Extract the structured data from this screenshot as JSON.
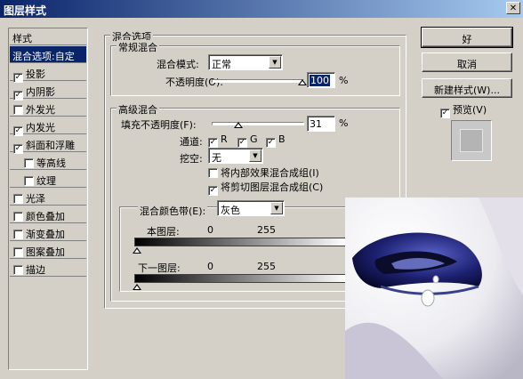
{
  "window": {
    "title": "图层样式",
    "close_glyph": "✕"
  },
  "style_list": {
    "header": "样式",
    "blend_options": "混合选项:自定",
    "items": [
      {
        "label": "投影",
        "checked": true
      },
      {
        "label": "内阴影",
        "checked": true
      },
      {
        "label": "外发光",
        "checked": false
      },
      {
        "label": "内发光",
        "checked": true
      },
      {
        "label": "斜面和浮雕",
        "checked": true
      },
      {
        "label": "等高线",
        "checked": false
      },
      {
        "label": "纹理",
        "checked": false
      },
      {
        "label": "光泽",
        "checked": false
      },
      {
        "label": "颜色叠加",
        "checked": false
      },
      {
        "label": "渐变叠加",
        "checked": false
      },
      {
        "label": "图案叠加",
        "checked": false
      },
      {
        "label": "描边",
        "checked": false
      }
    ]
  },
  "blend_options": {
    "title": "混合选项",
    "general": {
      "title": "常规混合",
      "mode_label": "混合模式:",
      "mode_value": "正常",
      "opacity_label": "不透明度(O):",
      "opacity_value": "100",
      "opacity_unit": "%"
    },
    "advanced": {
      "title": "高级混合",
      "fill_label": "填充不透明度(F):",
      "fill_value": "31",
      "fill_unit": "%",
      "channels_label": "通道:",
      "channels": [
        {
          "label": "R",
          "checked": true
        },
        {
          "label": "G",
          "checked": true
        },
        {
          "label": "B",
          "checked": true
        }
      ],
      "knockout_label": "挖空:",
      "knockout_value": "无",
      "check_inner_effects": {
        "label": "将内部效果混合成组(I)",
        "checked": false
      },
      "check_clipped_layers": {
        "label": "将剪切图层混合成组(C)",
        "checked": true
      }
    },
    "blend_if": {
      "label": "混合颜色带(E):",
      "value": "灰色",
      "this_layer_label": "本图层:",
      "this_layer_min": "0",
      "this_layer_max": "255",
      "underlying_label": "下一图层:",
      "underlying_min": "0",
      "underlying_max": "255"
    }
  },
  "buttons": {
    "ok": "好",
    "cancel": "取消",
    "new_style": "新建样式(W)...",
    "preview_label": "预览(V)",
    "preview_checked": true
  },
  "colors": {
    "selection": "#0a246a",
    "dialog_bg": "#d4d0c8"
  }
}
